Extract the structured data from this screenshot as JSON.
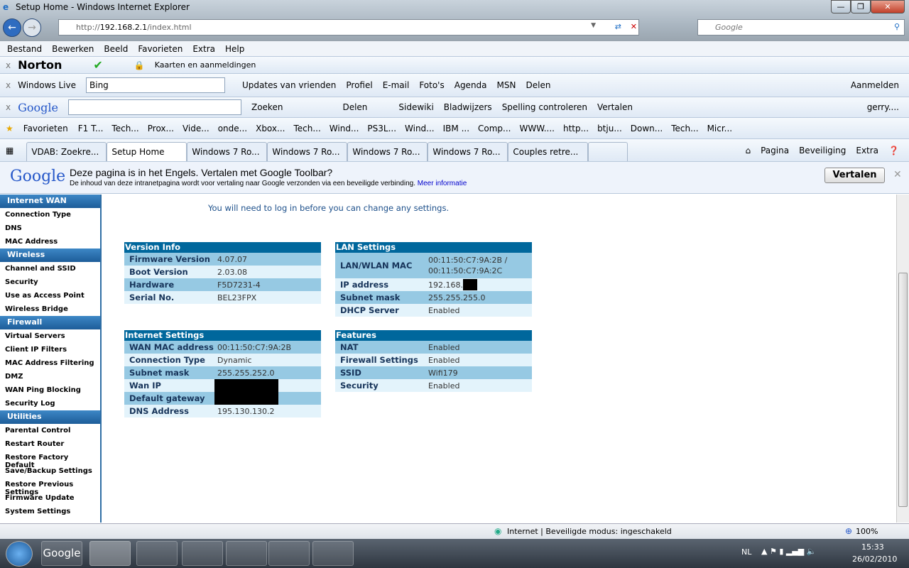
{
  "window": {
    "title": "Setup Home - Windows Internet Explorer",
    "url_prefix": "http://",
    "url_host": "192.168.2.1",
    "url_path": "/index.html",
    "search_placeholder": "Google"
  },
  "menu": [
    "Bestand",
    "Bewerken",
    "Beeld",
    "Favorieten",
    "Extra",
    "Help"
  ],
  "norton": {
    "brand": "Norton",
    "cards": "Kaarten en aanmeldingen"
  },
  "live": {
    "brand": "Windows Live",
    "search_value": "Bing",
    "links": [
      "Updates van vrienden",
      "Profiel",
      "E-mail",
      "Foto's",
      "Agenda",
      "MSN",
      "Delen"
    ],
    "signin": "Aanmelden"
  },
  "gtoolbar": {
    "brand": "Google",
    "search": "Zoeken",
    "share": "Delen",
    "sidewiki": "Sidewiki",
    "bookmarks": "Bladwijzers",
    "spell": "Spelling controleren",
    "translate": "Vertalen",
    "account": "gerry...."
  },
  "favorites": {
    "label": "Favorieten",
    "items": [
      "F1 T...",
      "Tech...",
      "Prox...",
      "Vide...",
      "onde...",
      "Xbox...",
      "Tech...",
      "Wind...",
      "PS3L...",
      "Wind...",
      "IBM ...",
      "Comp...",
      "WWW....",
      "http...",
      "btju...",
      "Down...",
      "Tech...",
      "Micr..."
    ]
  },
  "tabs": [
    "VDAB: Zoekre...",
    "Setup Home",
    "Windows 7 Ro...",
    "Windows 7 Ro...",
    "Windows 7 Ro...",
    "Windows 7 Ro...",
    "Couples retre..."
  ],
  "cmdbar": {
    "page": "Pagina",
    "security": "Beveiliging",
    "extra": "Extra"
  },
  "translate_bar": {
    "title": "Deze pagina is in het Engels. Vertalen met Google Toolbar?",
    "desc": "De inhoud van deze intranetpagina wordt voor vertaling naar Google verzonden via een beveiligde verbinding.",
    "link": "Meer informatie",
    "button": "Vertalen",
    "brand": "Google"
  },
  "sidebar": [
    {
      "header": "Internet WAN",
      "items": [
        "Connection Type",
        "DNS",
        "MAC Address"
      ]
    },
    {
      "header": "Wireless",
      "items": [
        "Channel and SSID",
        "Security",
        "Use as Access Point",
        "Wireless Bridge"
      ]
    },
    {
      "header": "Firewall",
      "items": [
        "Virtual Servers",
        "Client IP Filters",
        "MAC Address Filtering",
        "DMZ",
        "WAN Ping Blocking",
        "Security Log"
      ]
    },
    {
      "header": "Utilities",
      "items": [
        "Parental Control",
        "Restart Router",
        "Restore Factory Default",
        "Save/Backup Settings",
        "Restore Previous Settings",
        "Firmware Update",
        "System Settings"
      ]
    }
  ],
  "notice": "You will need to log in before you can change any settings.",
  "panels": {
    "version": {
      "title": "Version Info",
      "rows": [
        [
          "Firmware Version",
          "4.07.07"
        ],
        [
          "Boot Version",
          "2.03.08"
        ],
        [
          "Hardware",
          "F5D7231-4"
        ],
        [
          "Serial No.",
          "BEL23FPX"
        ]
      ]
    },
    "lan": {
      "title": "LAN Settings",
      "rows": [
        [
          "LAN/WLAN MAC",
          "00:11:50:C7:9A:2B / 00:11:50:C7:9A:2C"
        ],
        [
          "IP address",
          "192.168."
        ],
        [
          "Subnet mask",
          "255.255.255.0"
        ],
        [
          "DHCP Server",
          "Enabled"
        ]
      ]
    },
    "internet": {
      "title": "Internet Settings",
      "rows": [
        [
          "WAN MAC address",
          "00:11:50:C7:9A:2B"
        ],
        [
          "Connection Type",
          "Dynamic"
        ],
        [
          "Subnet mask",
          "255.255.252.0"
        ],
        [
          "Wan IP",
          ""
        ],
        [
          "Default gateway",
          ""
        ],
        [
          "DNS Address",
          "195.130.130.2"
        ]
      ]
    },
    "features": {
      "title": "Features",
      "rows": [
        [
          "NAT",
          "Enabled"
        ],
        [
          "Firewall Settings",
          "Enabled"
        ],
        [
          "SSID",
          "Wifi179"
        ],
        [
          "Security",
          "Enabled"
        ]
      ]
    }
  },
  "status": {
    "zone": "Internet | Beveiligde modus: ingeschakeld",
    "zoom": "100%"
  },
  "taskbar": {
    "google": "Google",
    "lang": "NL",
    "time": "15:33",
    "date": "26/02/2010"
  }
}
